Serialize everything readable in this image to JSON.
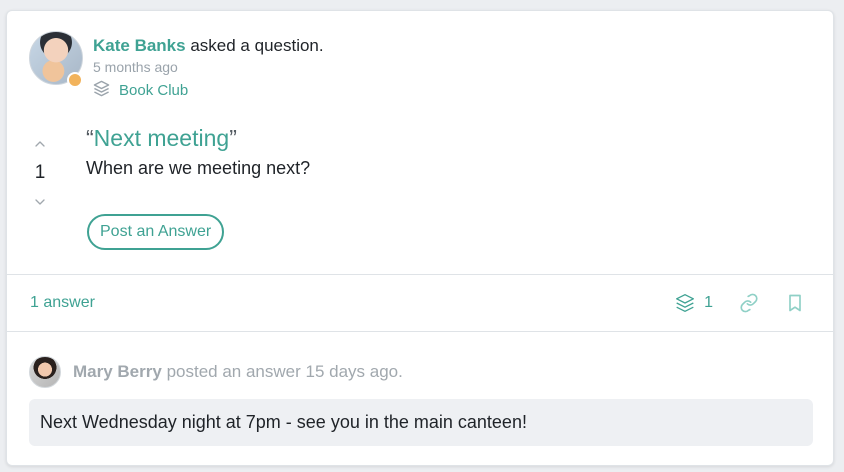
{
  "post": {
    "author_name": "Kate Banks",
    "author_action": "asked a question.",
    "time_ago": "5 months ago",
    "group_name": "Book Club",
    "vote_count": "1",
    "title": "Next meeting",
    "body": "When are we meeting next?",
    "answer_button_label": "Post an Answer",
    "answers_summary": "1 answer",
    "group_count": "1",
    "icons": {
      "group_icon": "layers-icon",
      "upvote_icon": "chevron-up-icon",
      "downvote_icon": "chevron-down-icon",
      "link_icon": "link-icon",
      "bookmark_icon": "bookmark-icon"
    },
    "colors": {
      "accent": "#3fa293",
      "presence_dot": "#f2b35c",
      "muted_text": "#9aa3ab"
    }
  },
  "answer": {
    "author_name": "Mary Berry",
    "meta_text": "posted an answer 15 days ago.",
    "text": "Next Wednesday night at 7pm - see you in the main canteen!"
  }
}
